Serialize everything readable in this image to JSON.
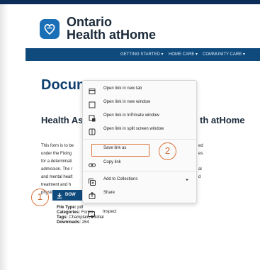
{
  "brand": {
    "line1": "Ontario",
    "line2": "Health atHome",
    "color": "#1b6fb6"
  },
  "nav": {
    "items": [
      "GETTING STARTED",
      "HOME CARE",
      "COMMUNITY CARE"
    ],
    "caret": "▾"
  },
  "page": {
    "title_visible": "Docun",
    "subtitle_left": "Health As",
    "subtitle_right": "th atHome",
    "para_lines_left": [
      "This form is to be",
      "under the Fixing",
      "for a determinati",
      "admission. The r",
      "and mental healt",
      "treatment and h",
      "physician or regi"
    ],
    "para_lines_right": [
      "ed",
      "es",
      "",
      "al",
      "d",
      "",
      ""
    ],
    "download_label": "DOW",
    "meta": {
      "file_type_label": "File Type:",
      "file_type": "pdf",
      "categories_label": "Categories:",
      "categories": "Forms",
      "tags_label": "Tags:",
      "tags": "Champlain, Global",
      "downloads_label": "Downloads:",
      "downloads": "264"
    }
  },
  "context_menu": {
    "items": [
      {
        "label": "Open link in new tab",
        "icon": "new-tab-icon"
      },
      {
        "label": "Open link in new window",
        "icon": "new-window-icon"
      },
      {
        "label": "Open link in InPrivate window",
        "icon": "inprivate-window-icon"
      },
      {
        "label": "Open link in split screen window",
        "icon": "split-screen-icon"
      },
      {
        "label": "Save link as",
        "icon": "none"
      },
      {
        "label": "Copy link",
        "icon": "link-icon"
      },
      {
        "label": "Add to Collections",
        "icon": "collections-icon",
        "submenu": "▸"
      },
      {
        "label": "Share",
        "icon": "share-icon"
      },
      {
        "label": "Inspect",
        "icon": "inspect-icon"
      }
    ]
  },
  "annotations": {
    "badge1": "1",
    "badge2": "2",
    "accent": "#d9743c"
  }
}
